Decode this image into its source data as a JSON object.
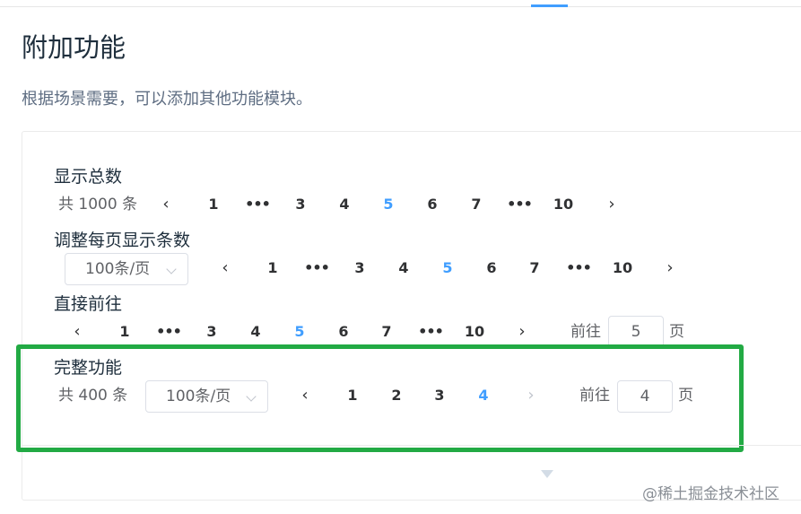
{
  "header": {
    "title": "附加功能",
    "description": "根据场景需要，可以添加其他功能模块。"
  },
  "sections": {
    "total": {
      "title": "显示总数",
      "total_text": "共 1000 条",
      "prev": "‹",
      "next": "›",
      "pages": [
        "1",
        "•••",
        "3",
        "4",
        "5",
        "6",
        "7",
        "•••",
        "10"
      ],
      "active_page": "5"
    },
    "sizes": {
      "title": "调整每页显示条数",
      "page_size": "100条/页",
      "prev": "‹",
      "next": "›",
      "pages": [
        "1",
        "•••",
        "3",
        "4",
        "5",
        "6",
        "7",
        "•••",
        "10"
      ],
      "active_page": "5"
    },
    "jumper": {
      "title": "直接前往",
      "prev": "‹",
      "next": "›",
      "pages": [
        "1",
        "•••",
        "3",
        "4",
        "5",
        "6",
        "7",
        "•••",
        "10"
      ],
      "active_page": "5",
      "goto_label": "前往",
      "goto_value": "5",
      "page_unit": "页"
    },
    "full": {
      "title": "完整功能",
      "total_text": "共 400 条",
      "page_size": "100条/页",
      "prev": "‹",
      "next": "›",
      "pages": [
        "1",
        "2",
        "3",
        "4"
      ],
      "active_page": "4",
      "goto_label": "前往",
      "goto_value": "4",
      "page_unit": "页"
    }
  },
  "icons": {
    "expand": "caret-down-icon",
    "chevron": "chevron-down-icon"
  },
  "colors": {
    "accent": "#409eff",
    "highlight": "#22aa44",
    "text": "#303133",
    "muted": "#606266"
  },
  "watermark": "@稀土掘金技术社区"
}
